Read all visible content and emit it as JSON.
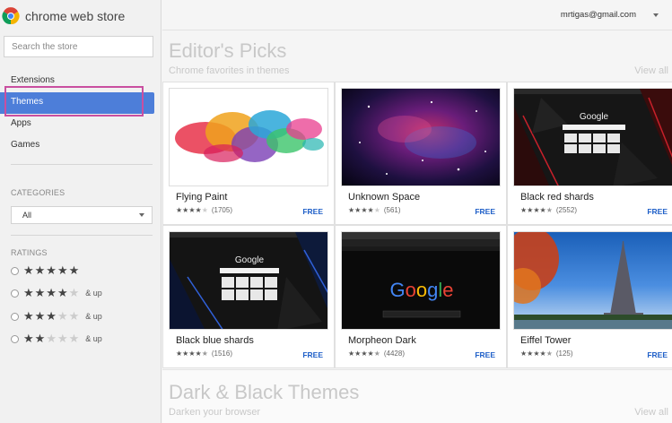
{
  "store": {
    "title": "chrome web store",
    "search_placeholder": "Search the store"
  },
  "nav": [
    {
      "label": "Extensions",
      "active": false
    },
    {
      "label": "Themes",
      "active": true
    },
    {
      "label": "Apps",
      "active": false
    },
    {
      "label": "Games",
      "active": false
    }
  ],
  "categories": {
    "label": "CATEGORIES",
    "selected": "All"
  },
  "ratings": {
    "label": "RATINGS",
    "options": [
      {
        "stars": 5,
        "suffix": ""
      },
      {
        "stars": 4,
        "suffix": "& up"
      },
      {
        "stars": 3,
        "suffix": "& up"
      },
      {
        "stars": 2,
        "suffix": "& up"
      }
    ]
  },
  "account": {
    "email": "mrtigas@gmail.com"
  },
  "editors_picks": {
    "title": "Editor's Picks",
    "subtitle": "Chrome favorites in themes",
    "view_all": "View all",
    "items": [
      {
        "name": "Flying Paint",
        "rating": 4,
        "count": "(1705)",
        "price": "FREE"
      },
      {
        "name": "Unknown Space",
        "rating": 4,
        "count": "(561)",
        "price": "FREE"
      },
      {
        "name": "Black red shards",
        "rating": 4.5,
        "count": "(2552)",
        "price": "FREE"
      },
      {
        "name": "Black blue shards",
        "rating": 4.5,
        "count": "(1516)",
        "price": "FREE"
      },
      {
        "name": "Morpheon Dark",
        "rating": 4.5,
        "count": "(4428)",
        "price": "FREE"
      },
      {
        "name": "Eiffel Tower",
        "rating": 4.5,
        "count": "(125)",
        "price": "FREE"
      }
    ]
  },
  "dark_themes": {
    "title": "Dark & Black Themes",
    "subtitle": "Darken your browser",
    "view_all": "View all"
  },
  "thumb_text": {
    "google": "Google"
  },
  "colors": {
    "accent": "#4d7ed9",
    "highlight": "#c94fa0",
    "price": "#2060c8"
  }
}
